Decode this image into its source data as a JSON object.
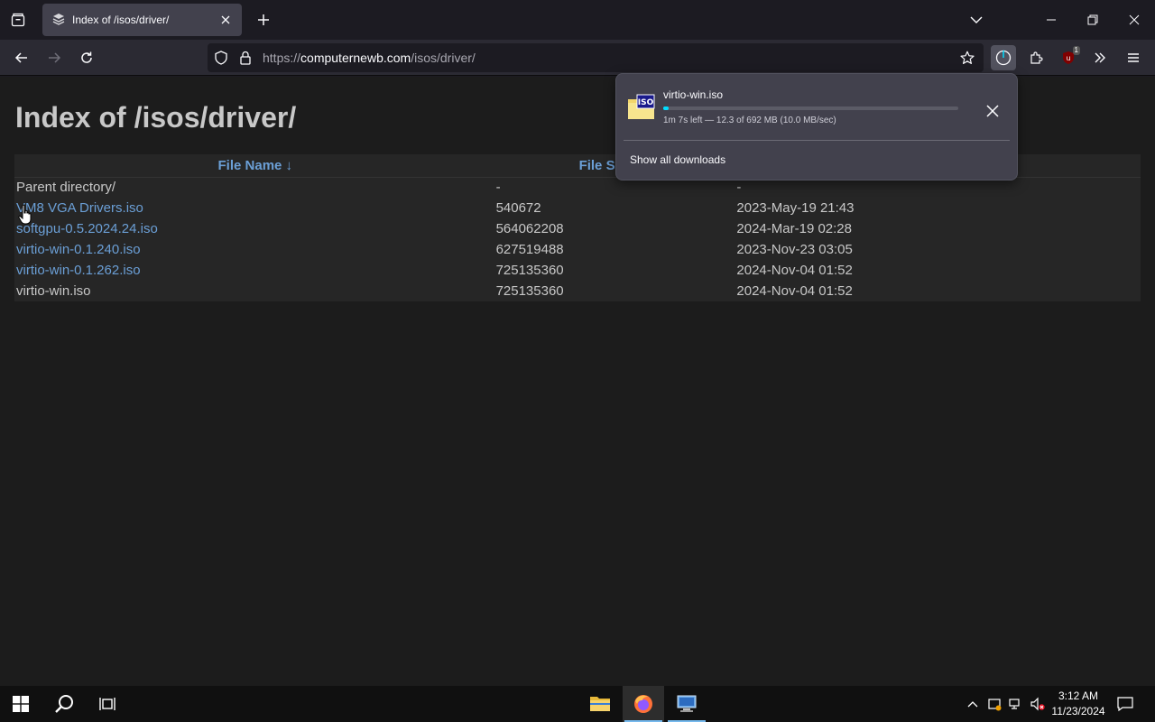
{
  "browser": {
    "tab_title": "Index of /isos/driver/",
    "url_host": "computernewb.com",
    "url_prefix": "https://",
    "url_path": "/isos/driver/",
    "extension_badge": "1"
  },
  "page": {
    "heading": "Index of /isos/driver/",
    "columns": {
      "name": "File Name  ↓",
      "size": "File S"
    },
    "rows": [
      {
        "name": "Parent directory/",
        "size": "-",
        "date": "-",
        "link": false
      },
      {
        "name": "VM8 VGA Drivers.iso",
        "size": "540672",
        "date": "2023-May-19 21:43",
        "link": true
      },
      {
        "name": "softgpu-0.5.2024.24.iso",
        "size": "564062208",
        "date": "2024-Mar-19 02:28",
        "link": true
      },
      {
        "name": "virtio-win-0.1.240.iso",
        "size": "627519488",
        "date": "2023-Nov-23 03:05",
        "link": true
      },
      {
        "name": "virtio-win-0.1.262.iso",
        "size": "725135360",
        "date": "2024-Nov-04 01:52",
        "link": true
      },
      {
        "name": "virtio-win.iso",
        "size": "725135360",
        "date": "2024-Nov-04 01:52",
        "link": false
      }
    ]
  },
  "downloads": {
    "filename": "virtio-win.iso",
    "icon_label": "ISO",
    "status": "1m 7s left — 12.3 of 692 MB (10.0 MB/sec)",
    "progress": 0.018,
    "show_all": "Show all downloads"
  },
  "taskbar": {
    "time": "3:12 AM",
    "date": "11/23/2024"
  },
  "colors": {
    "link": "#6b9fd6",
    "accent_download": "#00ddff"
  }
}
